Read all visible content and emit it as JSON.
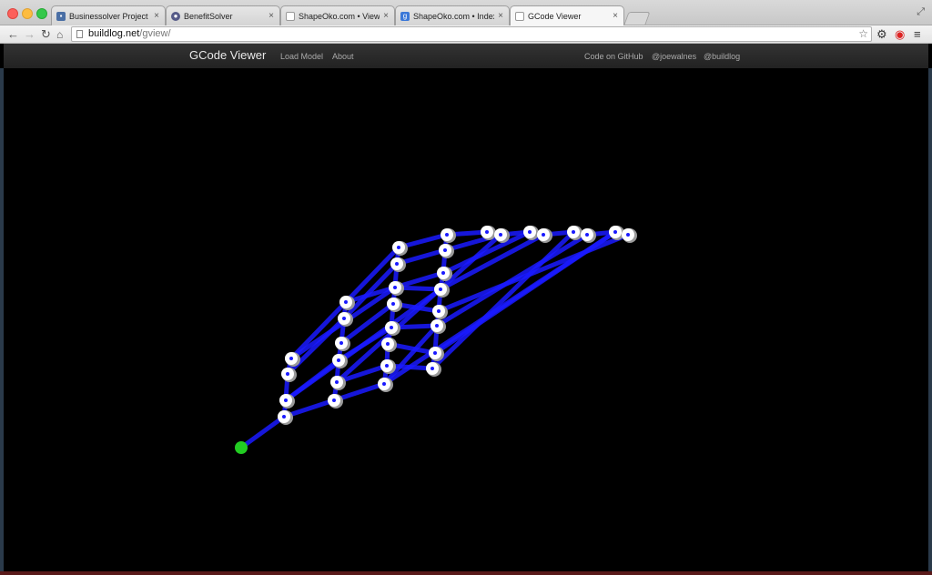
{
  "browser": {
    "tabs": [
      {
        "title": "Businessolver Project Mana",
        "favicon_color": "#4a6fa5",
        "favicon_glyph": "▪"
      },
      {
        "title": "BenefitSolver",
        "favicon_color": "#555a88",
        "favicon_glyph": "●"
      },
      {
        "title": "ShapeOko.com • View top",
        "favicon_color": "#ffffff",
        "favicon_glyph": ""
      },
      {
        "title": "ShapeOko.com • Index pa",
        "favicon_color": "#3b78d8",
        "favicon_glyph": "g"
      },
      {
        "title": "GCode Viewer",
        "favicon_color": "#ffffff",
        "favicon_glyph": ""
      }
    ],
    "active_tab": 4,
    "url_host": "buildlog.net",
    "url_path": "/gview/"
  },
  "site": {
    "brand": "GCode Viewer",
    "nav_left": [
      "Load Model",
      "About"
    ],
    "nav_right": [
      "Code on GitHub",
      "@joewalnes",
      "@buildlog"
    ]
  },
  "icons": {
    "back": "back-arrow-icon",
    "forward": "forward-arrow-icon",
    "reload": "reload-icon",
    "home": "home-icon",
    "star": "star-icon",
    "settings": "gear-icon",
    "extension": "opera-icon",
    "menu": "hamburger-menu-icon"
  },
  "colors": {
    "toolpath": "#1a1aff",
    "vertex": "#ffffff",
    "start_marker": "#22cc22"
  }
}
